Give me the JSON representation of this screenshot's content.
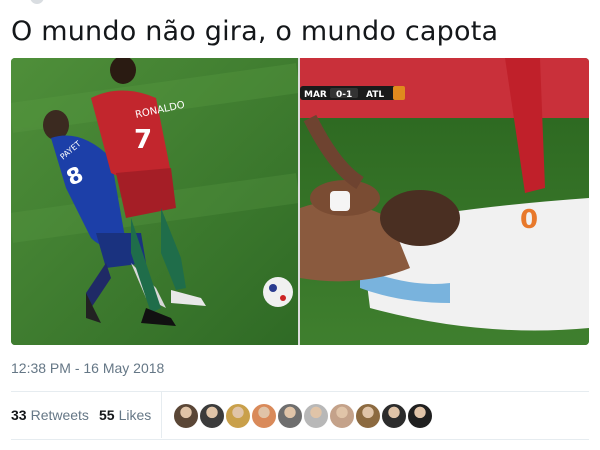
{
  "tweet": {
    "text": "O mundo não gira, o mundo capota",
    "timestamp": "12:38 PM - 16 May 2018"
  },
  "media": {
    "left_image": {
      "player_front_name": "RONALDO",
      "player_front_number": "7",
      "player_back_name": "PAYET",
      "player_back_number": "8"
    },
    "right_image": {
      "score_home": "MAR",
      "score": "0-1",
      "score_away": "ATL"
    }
  },
  "stats": {
    "retweets_count": "33",
    "retweets_label": "Retweets",
    "likes_count": "55",
    "likes_label": "Likes"
  },
  "avatars": [
    {
      "color": "#5a4636"
    },
    {
      "color": "#3b3b3b"
    },
    {
      "color": "#c9a04a"
    },
    {
      "color": "#d98a5a"
    },
    {
      "color": "#6e6e6e"
    },
    {
      "color": "#b8b8b8"
    },
    {
      "color": "#c4a28a"
    },
    {
      "color": "#8c6a40"
    },
    {
      "color": "#2c2c2c"
    },
    {
      "color": "#1f1f1f"
    }
  ]
}
